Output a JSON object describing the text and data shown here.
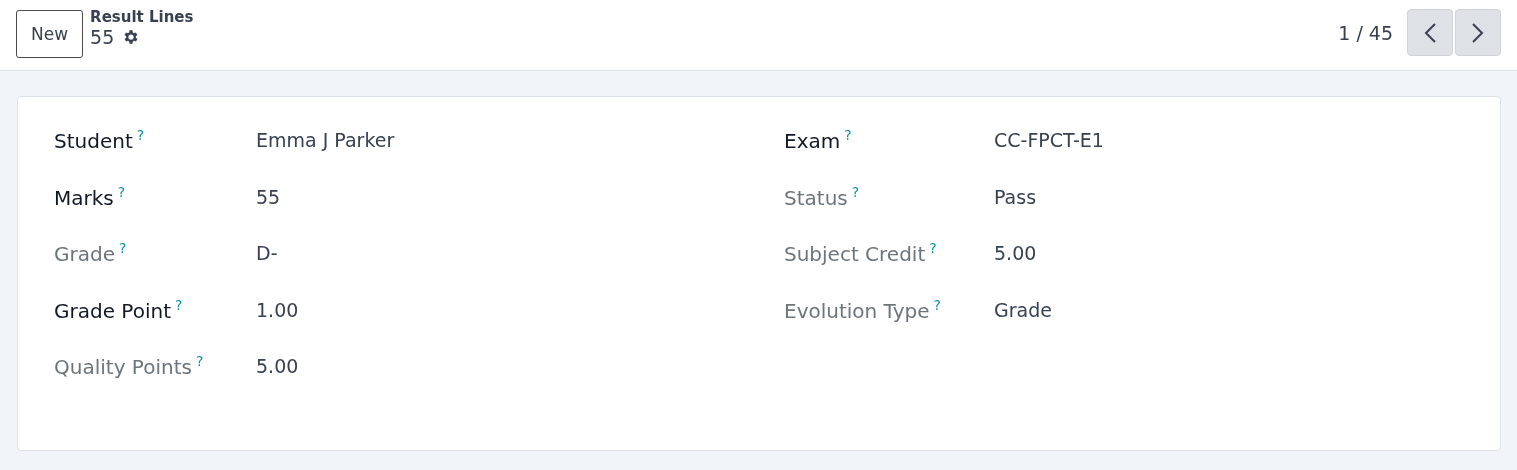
{
  "control_panel": {
    "new_button": "New",
    "breadcrumb": "Result Lines",
    "record_name": "55",
    "pager": "1 / 45"
  },
  "form": {
    "columns": [
      {
        "fields": [
          {
            "label": "Student",
            "help": "?",
            "value": "Emma J Parker",
            "readonly": false
          },
          {
            "label": "Marks",
            "help": "?",
            "value": "55",
            "readonly": false
          },
          {
            "label": "Grade",
            "help": "?",
            "value": "D-",
            "readonly": true
          },
          {
            "label": "Grade Point",
            "help": "?",
            "value": "1.00",
            "readonly": false
          },
          {
            "label": "Quality Points",
            "help": "?",
            "value": "5.00",
            "readonly": true
          }
        ]
      },
      {
        "fields": [
          {
            "label": "Exam",
            "help": "?",
            "value": "CC-FPCT-E1",
            "readonly": false
          },
          {
            "label": "Status",
            "help": "?",
            "value": "Pass",
            "readonly": true
          },
          {
            "label": "Subject Credit",
            "help": "?",
            "value": "5.00",
            "readonly": true
          },
          {
            "label": "Evolution Type",
            "help": "?",
            "value": "Grade",
            "readonly": true
          }
        ]
      }
    ]
  }
}
